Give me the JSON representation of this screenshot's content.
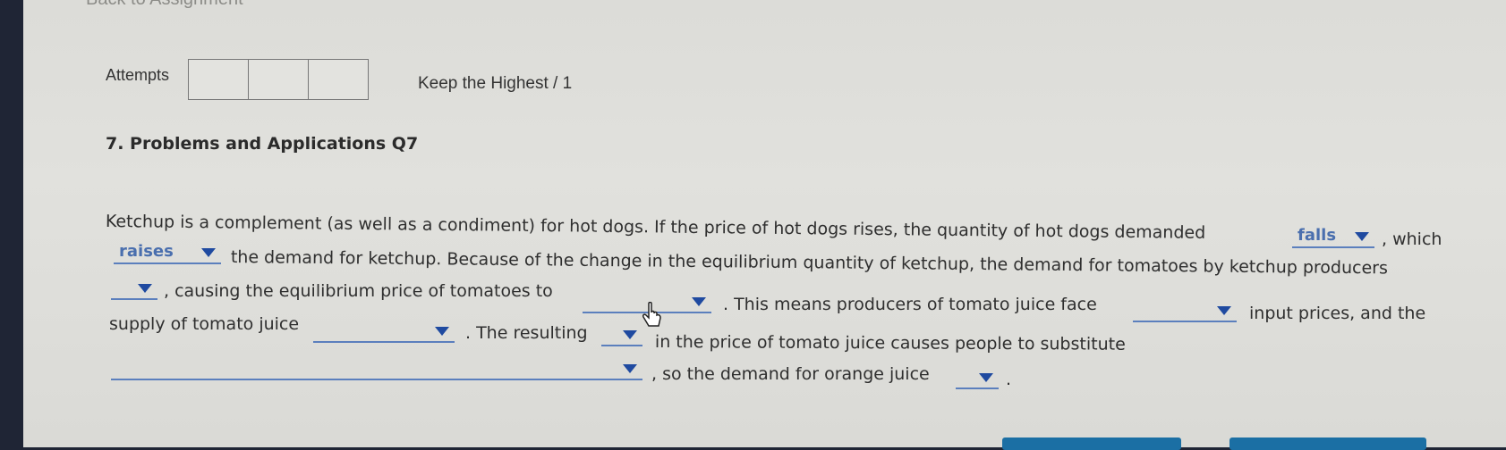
{
  "header": {
    "cutoff_text": "Back to Assignment"
  },
  "attempts": {
    "label": "Attempts",
    "boxes": [
      "",
      "",
      ""
    ],
    "keep": "Keep the Highest / 1"
  },
  "question": {
    "title": "7. Problems and Applications Q7",
    "text": {
      "l1": "Ketchup is a complement (as well as a condiment) for hot dogs. If the price of hot dogs rises, the quantity of hot dogs demanded",
      "l1b": ", which",
      "l2": "the demand for ketchup. Because of the change in the equilibrium quantity of ketchup, the demand for tomatoes by ketchup producers",
      "l3a": ", causing the equilibrium price of tomatoes to",
      "l3b": ". This means producers of tomato juice face",
      "l3c": "input prices, and the",
      "l4a": "supply of tomato juice",
      "l4b": ". The resulting",
      "l4c": "in the price of tomato juice causes people to substitute",
      "l5a": ", so the demand for orange juice",
      "l5b": "."
    },
    "dropdowns": {
      "d1": "falls",
      "d2": "raises",
      "d3": "",
      "d4": "",
      "d5": "",
      "d6": "",
      "d7": "",
      "d8": "",
      "d9": ""
    }
  },
  "colors": {
    "accent": "#4a6fae",
    "arrow": "#1f4aa0",
    "button": "#1b6fa4"
  }
}
